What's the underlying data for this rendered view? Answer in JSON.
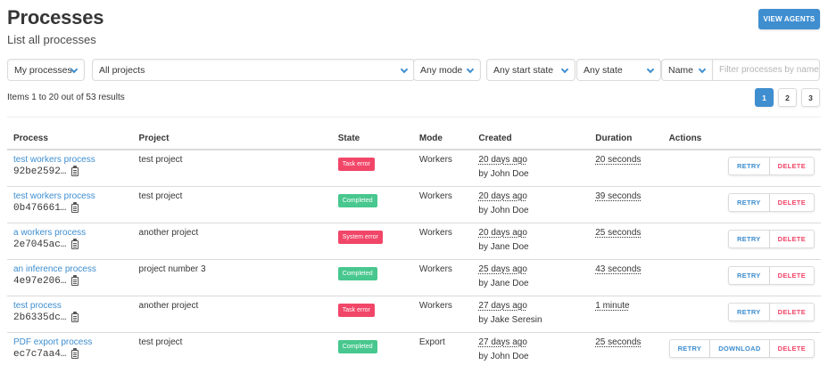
{
  "header": {
    "title": "Processes",
    "subtitle": "List all processes",
    "view_agents_label": "VIEW AGENTS"
  },
  "filters": {
    "owner": "My processes",
    "project": "All projects",
    "mode": "Any mode",
    "start_state": "Any start state",
    "state": "Any state",
    "sort": "Name",
    "search_placeholder": "Filter processes by name"
  },
  "results_count": "Items 1 to 20 out of 53 results",
  "pagination": [
    "1",
    "2",
    "3"
  ],
  "table": {
    "headers": [
      "Process",
      "Project",
      "State",
      "Mode",
      "Created",
      "Duration",
      "Actions"
    ],
    "rows": [
      {
        "name": "test workers process",
        "id": "92be2592…",
        "project": "test project",
        "state": "Task error",
        "state_color": "#f14668",
        "mode": "Workers",
        "created": "20 days ago",
        "by": "by John Doe",
        "duration": "20 seconds",
        "actions": [
          "RETRY",
          "DELETE"
        ]
      },
      {
        "name": "test workers process",
        "id": "0b476661…",
        "project": "test project",
        "state": "Completed",
        "state_color": "#48c78e",
        "mode": "Workers",
        "created": "20 days ago",
        "by": "by John Doe",
        "duration": "39 seconds",
        "actions": [
          "RETRY",
          "DELETE"
        ]
      },
      {
        "name": "a workers process",
        "id": "2e7045ac…",
        "project": "another project",
        "state": "System error",
        "state_color": "#f14668",
        "mode": "Workers",
        "created": "20 days ago",
        "by": "by Jane Doe",
        "duration": "25 seconds",
        "actions": [
          "RETRY",
          "DELETE"
        ]
      },
      {
        "name": "an inference process",
        "id": "4e97e206…",
        "project": "project number 3",
        "state": "Completed",
        "state_color": "#48c78e",
        "mode": "Workers",
        "created": "25 days ago",
        "by": "by Jane Doe",
        "duration": "43 seconds",
        "actions": [
          "RETRY",
          "DELETE"
        ]
      },
      {
        "name": "test process",
        "id": "2b6335dc…",
        "project": "another project",
        "state": "Task error",
        "state_color": "#f14668",
        "mode": "Workers",
        "created": "27 days ago",
        "by": "by Jake Seresin",
        "duration": "1 minute",
        "actions": [
          "RETRY",
          "DELETE"
        ]
      },
      {
        "name": "PDF export process",
        "id": "ec7c7aa4…",
        "project": "test project",
        "state": "Completed",
        "state_color": "#48c78e",
        "mode": "Export",
        "created": "27 days ago",
        "by": "by John Doe",
        "duration": "25 seconds",
        "actions": [
          "RETRY",
          "DOWNLOAD",
          "DELETE"
        ]
      }
    ]
  },
  "colors": {
    "accent": "#3e8ed0",
    "danger": "#f14668",
    "success": "#48c78e"
  }
}
